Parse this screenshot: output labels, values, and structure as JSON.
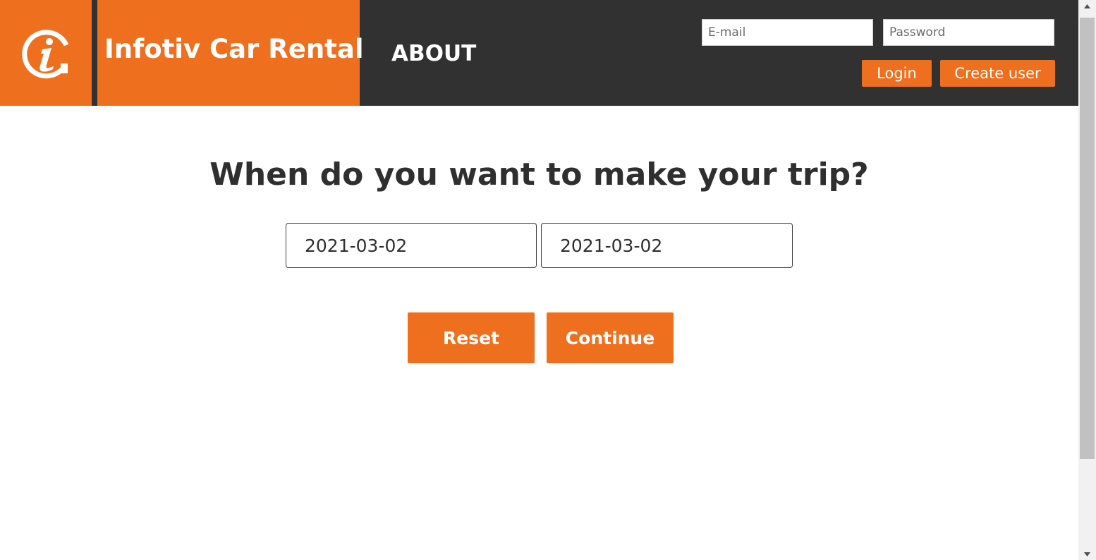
{
  "header": {
    "brand_title": "Infotiv Car Rental",
    "nav": {
      "about_label": "ABOUT"
    },
    "login": {
      "email_placeholder": "E-mail",
      "password_placeholder": "Password",
      "login_label": "Login",
      "create_user_label": "Create user"
    }
  },
  "main": {
    "title": "When do you want to make your trip?",
    "start_date": "2021-03-02",
    "end_date": "2021-03-02",
    "reset_label": "Reset",
    "continue_label": "Continue"
  },
  "icons": {
    "logo": "infotiv-logo-icon",
    "scroll_up": "chevron-up-icon",
    "scroll_down": "chevron-down-icon"
  },
  "colors": {
    "brand_orange": "#ee701f",
    "header_dark": "#313131",
    "text_dark": "#2f2f2f"
  }
}
